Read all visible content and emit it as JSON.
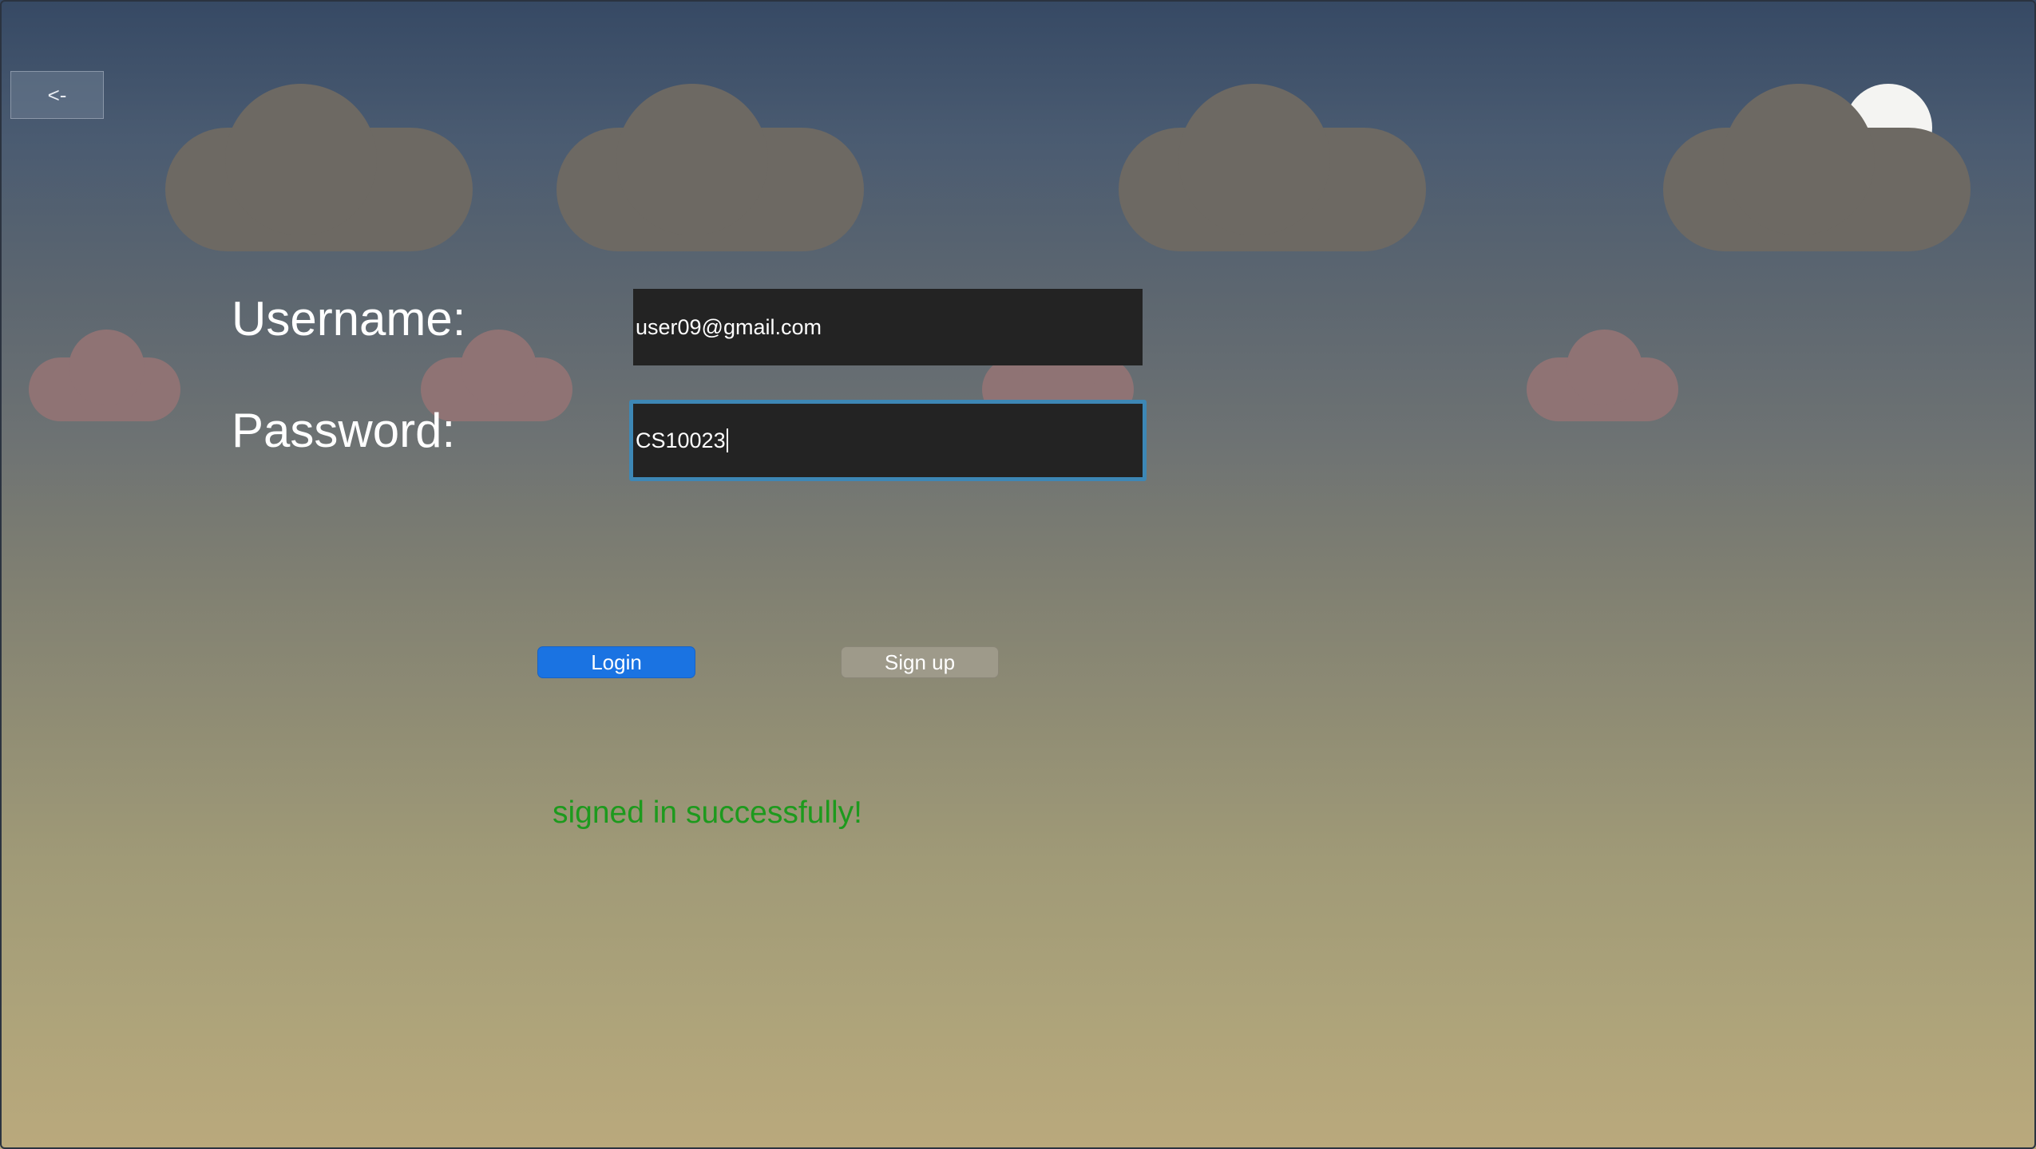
{
  "window": {
    "back_label": "<-"
  },
  "form": {
    "username_label": "Username:",
    "username_value": "user09@gmail.com",
    "password_label": "Password:",
    "password_value": "CS10023"
  },
  "actions": {
    "login_label": "Login",
    "signup_label": "Sign up"
  },
  "status": {
    "message": "signed in successfully!",
    "color": "#1d9a1d"
  },
  "theme": {
    "accent": "#1a73e2",
    "focus_ring": "#3d87b5",
    "input_bg": "#232323"
  },
  "decor": {
    "moon_icon": "moon-icon",
    "cloud_icon": "cloud-icon"
  }
}
